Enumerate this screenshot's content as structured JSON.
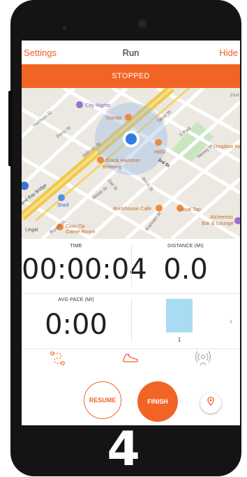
{
  "header": {
    "left": "Settings",
    "title": "Run",
    "right": "Hide"
  },
  "status": "STOPPED",
  "map": {
    "places": {
      "city_nights": "City Nights",
      "garaje": "Garaje",
      "hrd": "HRD",
      "black_hammer_1": "Black Hammer",
      "black_hammer_2": "Brewing",
      "shell": "Shell",
      "brickhouse": "Brickhouse Cafe",
      "local_tap": "Local Tap",
      "alchemist_1": "Alchemist",
      "alchemist_2": "Bar & Lounge",
      "coinop_1": "Coin-Op",
      "coinop_2": "Game Room",
      "dropbox": "Dropbox Inc",
      "legal": "Legal"
    },
    "streets": {
      "harrison": "Harrison St",
      "perry": "Perry St",
      "stillman": "Stillman St",
      "third": "3rd St",
      "zoe": "Zoe St",
      "welsh": "Welsh St",
      "birch": "Birch St",
      "bay_bridge": "land Bay Bridge",
      "s_park": "S Park",
      "tabor": "Tabor Pl",
      "varney": "Varney Pl",
      "bryant": "Bryant St",
      "brannan": "Brannan St",
      "twentyfirst": "21st"
    }
  },
  "stats": {
    "time_label": "TIME",
    "time_value": "00:00:04",
    "distance_label": "DISTANCE (MI)",
    "distance_value": "0.0",
    "pace_label": "AVG PACE (MI)",
    "pace_value": "0:00",
    "split_label": "1"
  },
  "tabs": [
    {
      "icon": "route-icon"
    },
    {
      "icon": "shoe-icon"
    },
    {
      "icon": "beacon-icon"
    }
  ],
  "actions": {
    "resume": "RESUME",
    "finish": "FINISH",
    "location_icon": "location-pin-icon"
  },
  "step_label": "4",
  "colors": {
    "accent": "#f26425",
    "split_bar": "#a9dcf3",
    "map_bg": "#ece9e2"
  }
}
